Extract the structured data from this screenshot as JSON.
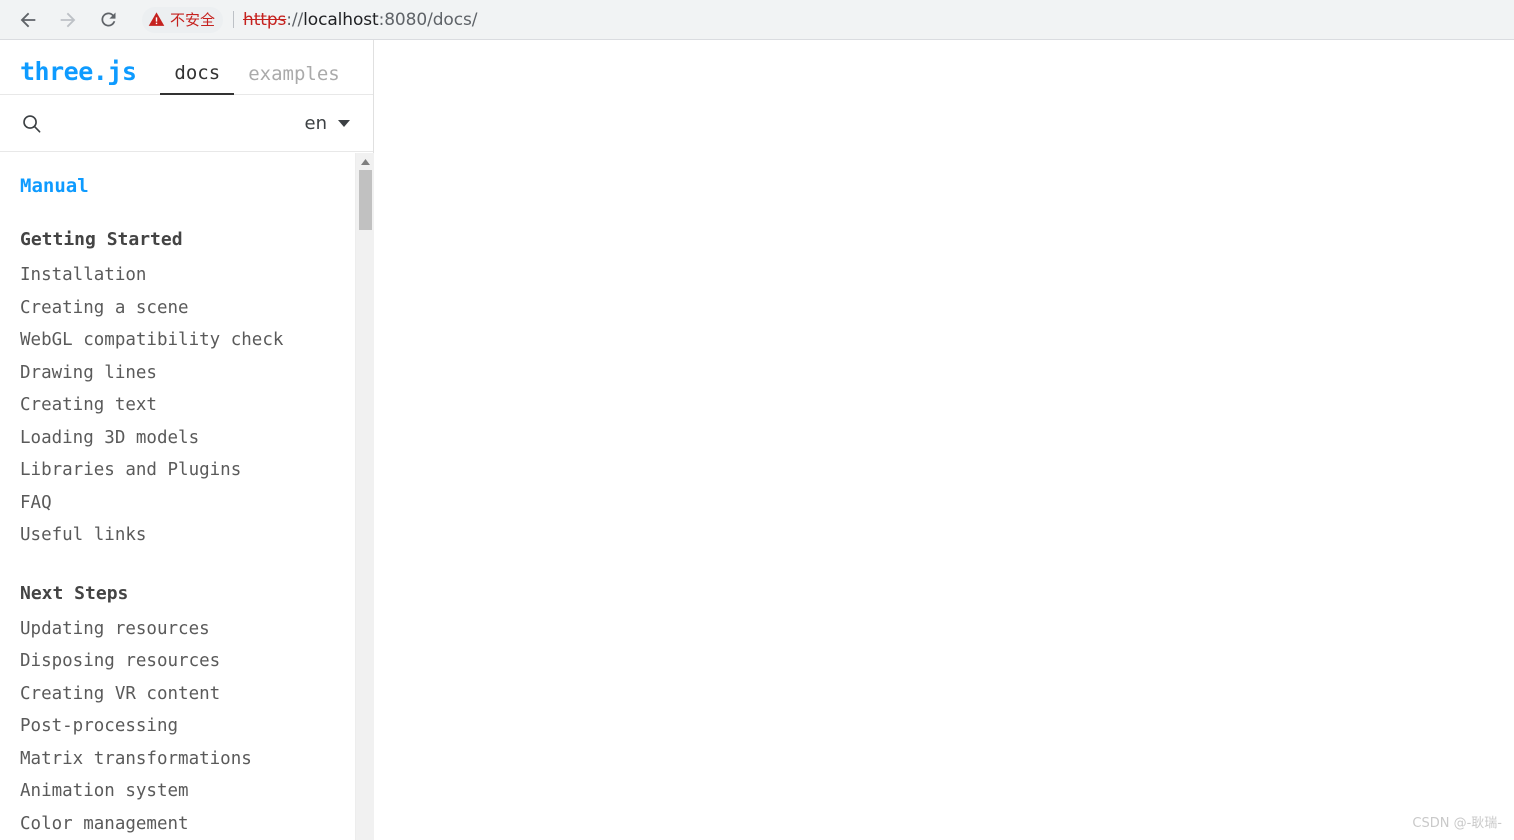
{
  "browser": {
    "back_label": "Back",
    "forward_label": "Forward",
    "reload_label": "Reload",
    "security": {
      "icon": "warning-triangle-icon",
      "text": "不安全",
      "color": "#c5221f"
    },
    "url": {
      "scheme": "https",
      "separator": "://",
      "host": "localhost",
      "rest": ":8080/docs/",
      "full": "https://localhost:8080/docs/"
    }
  },
  "panel": {
    "brand": "three.js",
    "brand_color": "#0e9bff",
    "tabs": [
      {
        "label": "docs",
        "active": true
      },
      {
        "label": "examples",
        "active": false
      }
    ],
    "search": {
      "icon": "search-icon",
      "value": "",
      "placeholder": ""
    },
    "language": {
      "value": "en",
      "icon": "chevron-down-icon"
    },
    "nav_title": "Manual",
    "sections": [
      {
        "heading": "Getting Started",
        "items": [
          "Installation",
          "Creating a scene",
          "WebGL compatibility check",
          "Drawing lines",
          "Creating text",
          "Loading 3D models",
          "Libraries and Plugins",
          "FAQ",
          "Useful links"
        ]
      },
      {
        "heading": "Next Steps",
        "items": [
          "Updating resources",
          "Disposing resources",
          "Creating VR content",
          "Post-processing",
          "Matrix transformations",
          "Animation system",
          "Color management"
        ]
      }
    ],
    "scrollbar": {
      "up_arrow_icon": "triangle-up-icon"
    }
  },
  "watermark": "CSDN @-耿瑞-"
}
